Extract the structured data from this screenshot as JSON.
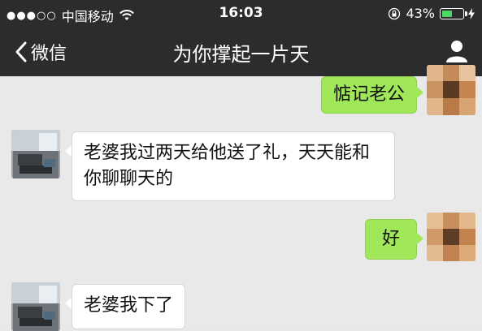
{
  "status_bar": {
    "signal_dots": "●●●○○",
    "carrier": "中国移动",
    "time": "16:03",
    "battery_percent": "43%",
    "battery_level": 0.43,
    "battery_color": "#4cd964",
    "icons": [
      "wifi-icon",
      "orientation-lock-icon",
      "battery-icon",
      "charging-icon"
    ]
  },
  "nav": {
    "back_label": "微信",
    "title": "为你撑起一片天",
    "icons": [
      "back-chevron-icon",
      "user-profile-icon"
    ]
  },
  "messages": [
    {
      "side": "right",
      "sender": "self",
      "text": "惦记老公"
    },
    {
      "side": "left",
      "sender": "other",
      "line1": "老婆我过两天给他送了礼，天天能和",
      "line2": "你聊聊天的"
    },
    {
      "side": "right",
      "sender": "self",
      "text": "好"
    },
    {
      "side": "left",
      "sender": "other",
      "text": "老婆我下了"
    }
  ],
  "colors": {
    "header": "#2c2c2e",
    "chat_background": "#e9e9e9",
    "self_bubble": "#a0e75a",
    "other_bubble": "#ffffff"
  }
}
